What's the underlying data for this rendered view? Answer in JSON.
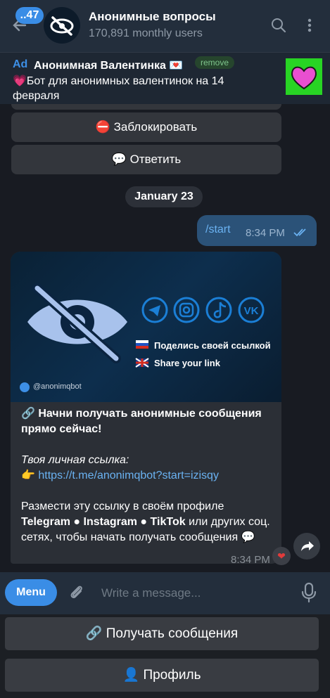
{
  "header": {
    "unread_count": "..47",
    "title": "Анонимные вопросы",
    "subtitle": "170,891 monthly users"
  },
  "ad": {
    "label": "Ad",
    "title": "Анонимная Валентинка 💌",
    "remove": "remove",
    "text": "💗Бот для анонимных валентинок на 14 февраля"
  },
  "keyboard_buttons": {
    "block": "⛔ Заблокировать",
    "reply": "💬 Ответить"
  },
  "date_divider": "January 23",
  "outgoing": {
    "text": "/start",
    "time": "8:34 PM"
  },
  "banner": {
    "share_ru": "Поделись своей ссылкой",
    "share_en": "Share your link",
    "handle": "@anonimqbot"
  },
  "incoming": {
    "line1": "🔗 Начни получать анонимные сообщения прямо сейчас!",
    "line2_italic": "Твоя личная ссылка:",
    "link_prefix": "👉 ",
    "link": "https://t.me/anonimqbot?start=izisqy",
    "line3_part1": "Размести эту ссылку в своём профиле ",
    "line3_bold": "Telegram ● Instagram ● TikTok",
    "line3_part2": " или других соц. сетях, чтобы начать получать сообщения 💬",
    "time": "8:34 PM",
    "reaction": "❤"
  },
  "input": {
    "menu": "Menu",
    "placeholder": "Write a message..."
  },
  "reply_keyboard": {
    "get_messages": "🔗 Получать сообщения",
    "profile": "👤 Профиль"
  }
}
